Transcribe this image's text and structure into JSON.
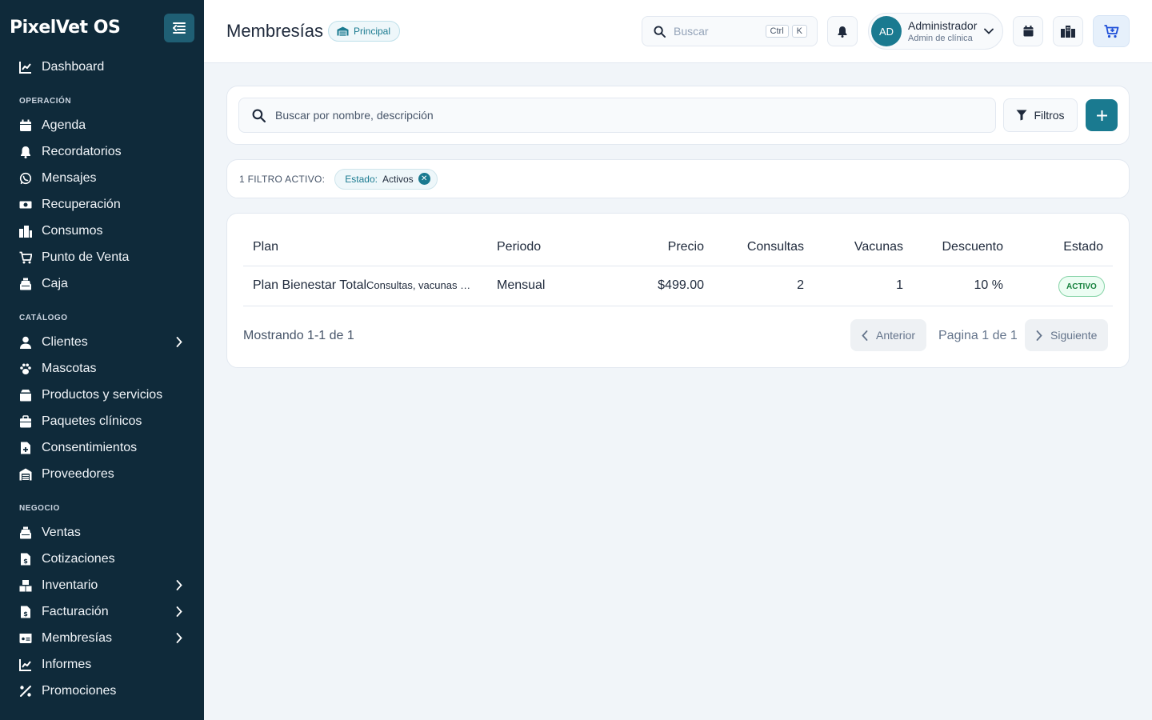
{
  "app": {
    "brand": "PixelVet OS"
  },
  "sidebar": {
    "top_items": [
      {
        "label": "Dashboard",
        "icon": "chart-line-icon"
      }
    ],
    "sections": [
      {
        "title": "OPERACIÓN",
        "items": [
          {
            "label": "Agenda",
            "icon": "calendar-icon"
          },
          {
            "label": "Recordatorios",
            "icon": "bell-icon"
          },
          {
            "label": "Mensajes",
            "icon": "whatsapp-icon"
          },
          {
            "label": "Recuperación",
            "icon": "money-icon"
          },
          {
            "label": "Consumos",
            "icon": "building-icon"
          },
          {
            "label": "Punto de Venta",
            "icon": "cart-icon"
          },
          {
            "label": "Caja",
            "icon": "cash-register-icon"
          }
        ]
      },
      {
        "title": "CATÁLOGO",
        "items": [
          {
            "label": "Clientes",
            "icon": "user-icon",
            "expandable": true
          },
          {
            "label": "Mascotas",
            "icon": "paw-icon"
          },
          {
            "label": "Productos y servicios",
            "icon": "box-icon"
          },
          {
            "label": "Paquetes clínicos",
            "icon": "package-icon"
          },
          {
            "label": "Consentimientos",
            "icon": "file-medical-icon"
          },
          {
            "label": "Proveedores",
            "icon": "warehouse-icon"
          }
        ]
      },
      {
        "title": "NEGOCIO",
        "items": [
          {
            "label": "Ventas",
            "icon": "cash-register-icon"
          },
          {
            "label": "Cotizaciones",
            "icon": "file-invoice-dollar-icon"
          },
          {
            "label": "Inventario",
            "icon": "boxes-icon",
            "expandable": true
          },
          {
            "label": "Facturación",
            "icon": "file-invoice-icon",
            "expandable": true
          },
          {
            "label": "Membresías",
            "icon": "id-card-icon",
            "expandable": true
          },
          {
            "label": "Informes",
            "icon": "chart-line-icon"
          },
          {
            "label": "Promociones",
            "icon": "percent-icon"
          }
        ]
      }
    ]
  },
  "header": {
    "title": "Membresías",
    "branch": "Principal",
    "search_placeholder": "Buscar",
    "shortcut": [
      "Ctrl",
      "K"
    ],
    "user": {
      "initials": "AD",
      "name": "Administrador",
      "role": "Admin de clínica"
    }
  },
  "toolbar": {
    "search_placeholder": "Buscar por nombre, descripción",
    "filters_label": "Filtros"
  },
  "filters": {
    "count_label": "1 FILTRO ACTIVO:",
    "chips": [
      {
        "key": "Estado:",
        "value": "Activos"
      }
    ]
  },
  "table": {
    "columns": [
      "Plan",
      "Periodo",
      "Precio",
      "Consultas",
      "Vacunas",
      "Descuento",
      "Estado"
    ],
    "rows": [
      {
        "plan": "Plan Bienestar Total",
        "description": "Consultas, vacunas …",
        "period": "Mensual",
        "price": "$499.00",
        "consultations": "2",
        "vaccines": "1",
        "discount": "10 %",
        "status": "ACTIVO"
      }
    ]
  },
  "pagination": {
    "showing": "Mostrando 1-1 de 1",
    "prev": "Anterior",
    "page": "Pagina 1 de 1",
    "next": "Siguiente"
  },
  "colors": {
    "sidebar": "#0f2a3a",
    "accent": "#1a7a90",
    "success": "#15803d"
  }
}
